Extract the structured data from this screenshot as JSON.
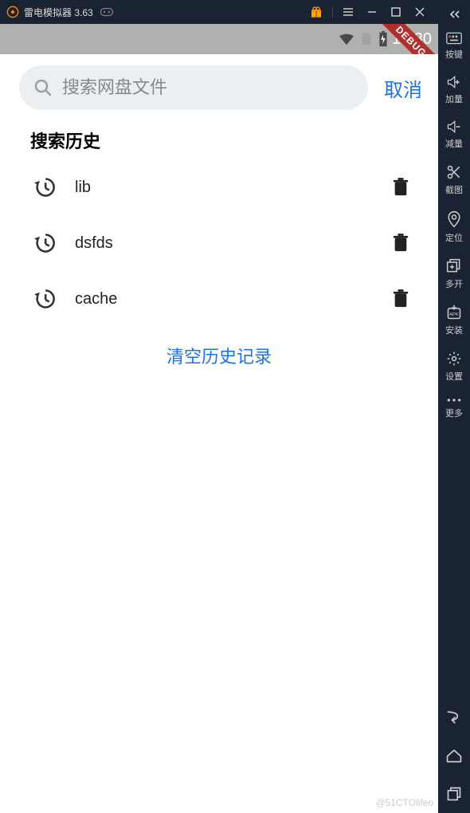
{
  "titlebar": {
    "title": "雷电模拟器 3.63"
  },
  "statusbar": {
    "time": "10:30",
    "debug": "DEBUG"
  },
  "search": {
    "placeholder": "搜索网盘文件",
    "cancel": "取消"
  },
  "history": {
    "title": "搜索历史",
    "items": [
      {
        "text": "lib"
      },
      {
        "text": "dsfds"
      },
      {
        "text": "cache"
      }
    ],
    "clear": "清空历史记录"
  },
  "sidebar": {
    "tools": [
      {
        "label": "按键"
      },
      {
        "label": "加量"
      },
      {
        "label": "减量"
      },
      {
        "label": "截图"
      },
      {
        "label": "定位"
      },
      {
        "label": "多开"
      },
      {
        "label": "安装"
      },
      {
        "label": "设置"
      },
      {
        "label": "更多"
      }
    ]
  },
  "watermark": "@51CTOlifeo"
}
